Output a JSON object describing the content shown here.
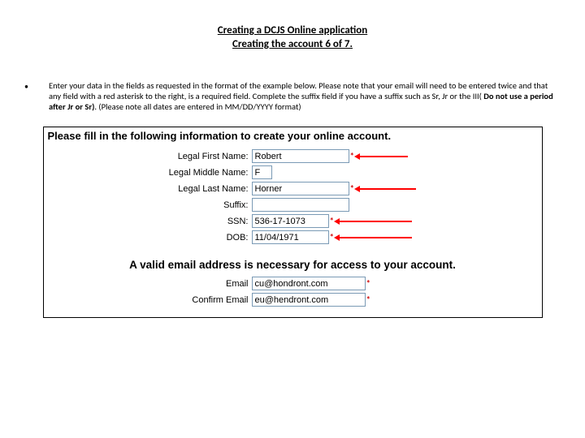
{
  "title": {
    "line1": "Creating a DCJS Online application",
    "line2": "Creating the account 6 of 7."
  },
  "bullet": {
    "text_before_bold": "Enter your data in the fields as requested in the format of the example below. Please note that your email will need to be entered twice and that any field with a red asterisk to the right, is a required field. Complete the suffix field if you have a suffix such as Sr, Jr or the III( ",
    "bold_part": "Do not use a period after Jr or Sr)",
    "text_after_bold": ". (Please note all dates are entered in MM/DD/YYYY format)"
  },
  "form": {
    "header": "Please fill in the following information to create your online account.",
    "fields": {
      "first_name": {
        "label": "Legal First Name:",
        "value": "Robert"
      },
      "middle_name": {
        "label": "Legal Middle Name:",
        "value": "F"
      },
      "last_name": {
        "label": "Legal Last Name:",
        "value": "Horner"
      },
      "suffix": {
        "label": "Suffix:",
        "value": ""
      },
      "ssn": {
        "label": "SSN:",
        "value": "536-17-1073"
      },
      "dob": {
        "label": "DOB:",
        "value": "11/04/1971"
      }
    },
    "email_header": "A valid email address is necessary for access to your account.",
    "email_fields": {
      "email": {
        "label": "Email",
        "value": "cu@hondront.com"
      },
      "confirm": {
        "label": "Confirm Email",
        "value": "eu@hendront.com"
      }
    },
    "asterisk": "*"
  }
}
